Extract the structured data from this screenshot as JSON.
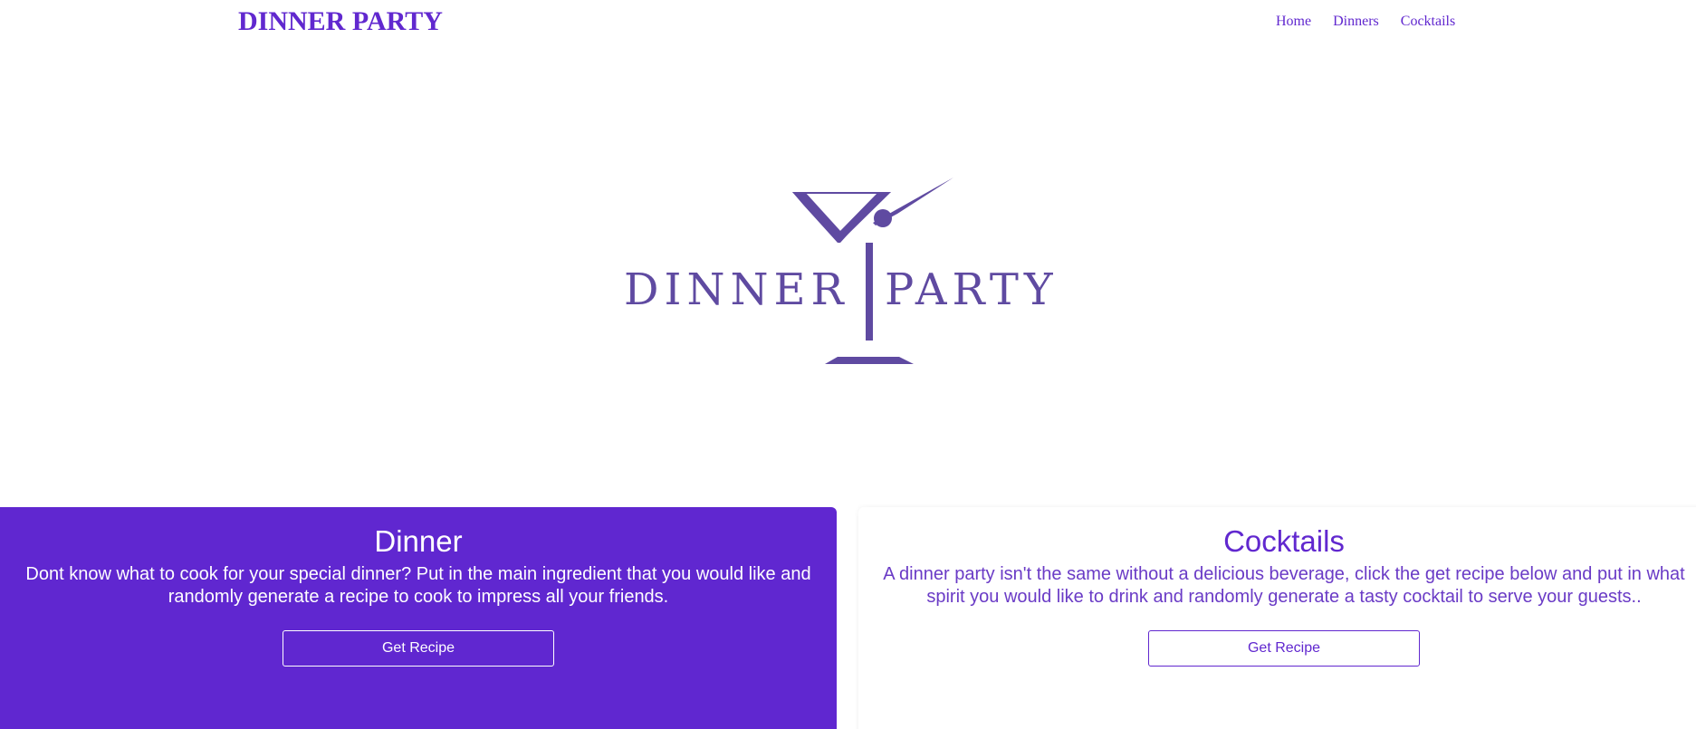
{
  "colors": {
    "brand": "#6128cf",
    "logo": "#5f4aa1",
    "dinner_card_bg": "#6027d0",
    "white": "#ffffff"
  },
  "nav": {
    "brand": "DINNER PARTY",
    "links": [
      "Home",
      "Dinners",
      "Cocktails"
    ]
  },
  "logo": {
    "word1": "DINNER",
    "word2": "PARTY",
    "icon": "martini-glass-icon"
  },
  "cards": {
    "dinner": {
      "title": "Dinner",
      "text": "Dont know what to cook for your special dinner? Put in the main ingredient that you would like and randomly generate a recipe to cook to impress all your friends.",
      "button": "Get Recipe"
    },
    "cocktails": {
      "title": "Cocktails",
      "text": "A dinner party isn't the same without a delicious beverage, click the get recipe below and put in what spirit you would like to drink and randomly generate a tasty cocktail to serve your guests..",
      "button": "Get Recipe"
    }
  }
}
